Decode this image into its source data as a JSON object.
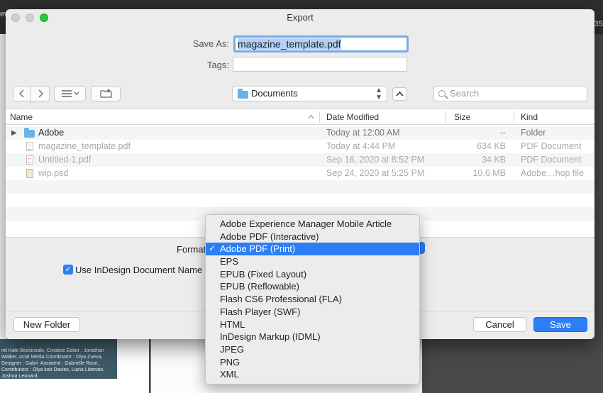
{
  "background": {
    "tab_fragment": "ew",
    "page_number": "35",
    "credits_text": "nd Kate Beckinsale, Creative Editor : Jonathan Walker, ocial Media Coordinator : Olya Zueva, Designer : Gabri- Assistent : Gabrielle Rose, Contributors : Olya kob Davies, Liana Liberato, Joshua Leonard."
  },
  "dialog": {
    "title": "Export",
    "save_as_label": "Save As:",
    "save_as_value": "magazine_template.pdf",
    "tags_label": "Tags:",
    "tags_value": ""
  },
  "toolbar": {
    "back_icon": "chevron-left",
    "forward_icon": "chevron-right",
    "view_icon": "list-view",
    "new_folder_icon": "folder-plus",
    "location": "Documents",
    "search_placeholder": "Search"
  },
  "file_list": {
    "columns": [
      "Name",
      "Date Modified",
      "Size",
      "Kind"
    ],
    "rows": [
      {
        "name": "Adobe",
        "date": "Today at 12:00 AM",
        "size": "--",
        "kind": "Folder",
        "icon": "folder",
        "enabled": true
      },
      {
        "name": "magazine_template.pdf",
        "date": "Today at 4:44 PM",
        "size": "634 KB",
        "kind": "PDF Document",
        "icon": "pdf",
        "enabled": false
      },
      {
        "name": "Untitled-1.pdf",
        "date": "Sep 16, 2020 at 8:52 PM",
        "size": "34 KB",
        "kind": "PDF Document",
        "icon": "pdf",
        "enabled": false
      },
      {
        "name": "wip.psd",
        "date": "Sep 24, 2020 at 5:25 PM",
        "size": "10.6 MB",
        "kind": "Adobe…hop file",
        "icon": "psd",
        "enabled": false
      }
    ]
  },
  "options": {
    "format_label": "Format:",
    "use_name_label": "Use InDesign Document Name",
    "use_name_checked": true
  },
  "buttons": {
    "new_folder": "New Folder",
    "cancel": "Cancel",
    "save": "Save"
  },
  "format_menu": {
    "selected": "Adobe PDF (Print)",
    "items": [
      "Adobe Experience Manager Mobile Article",
      "Adobe PDF (Interactive)",
      "Adobe PDF (Print)",
      "EPS",
      "EPUB (Fixed Layout)",
      "EPUB (Reflowable)",
      "Flash CS6 Professional (FLA)",
      "Flash Player (SWF)",
      "HTML",
      "InDesign Markup (IDML)",
      "JPEG",
      "PNG",
      "XML"
    ]
  },
  "colors": {
    "accent": "#2b7ef6",
    "zoom_button": "#27c93f",
    "folder": "#67b2e8"
  }
}
